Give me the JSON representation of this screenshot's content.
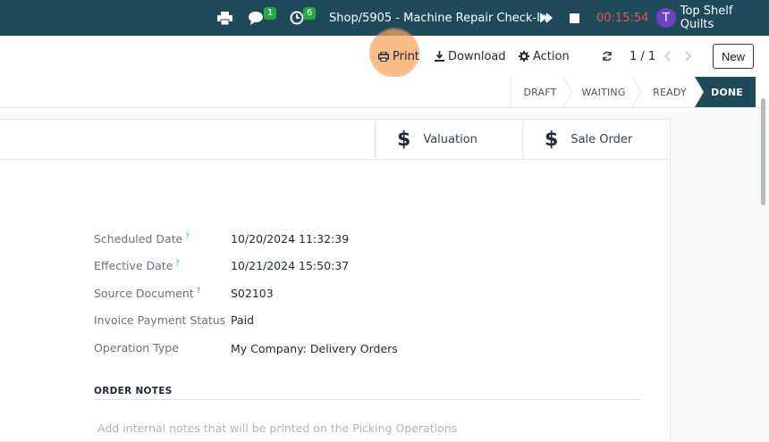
{
  "topbar": {
    "chat_count": "1",
    "activity_count": "6",
    "record_title": "Shop/5905 - Machine Repair Check-In",
    "timer": "00:15:54",
    "user_initial": "T",
    "company": "Top Shelf Quilts",
    "colors": {
      "bar": "#1f4a5a",
      "timer": "#e05a4e",
      "badge": "#28a745",
      "avatar": "#6f42c1"
    }
  },
  "controls": {
    "print_label": "Print",
    "download_label": "Download",
    "action_label": "Action",
    "pager": "1 / 1",
    "new_label": "New"
  },
  "stages": [
    "DRAFT",
    "WAITING",
    "READY",
    "DONE"
  ],
  "active_stage": "DONE",
  "smart_buttons": {
    "valuation": "Valuation",
    "sale_order": "Sale Order"
  },
  "fields": [
    {
      "label": "Scheduled Date",
      "help": "?",
      "value": "10/20/2024 11:32:39"
    },
    {
      "label": "Effective Date",
      "help": "?",
      "value": "10/21/2024 15:50:37"
    },
    {
      "label": "Source Document",
      "help": "?",
      "value": "S02103"
    },
    {
      "label": "Invoice Payment Status",
      "help": "",
      "value": "Paid"
    },
    {
      "label": "Operation Type",
      "help": "",
      "value": "My Company: Delivery Orders"
    }
  ],
  "notes": {
    "title": "ORDER NOTES",
    "placeholder": "Add internal notes that will be printed on the Picking Operations"
  }
}
